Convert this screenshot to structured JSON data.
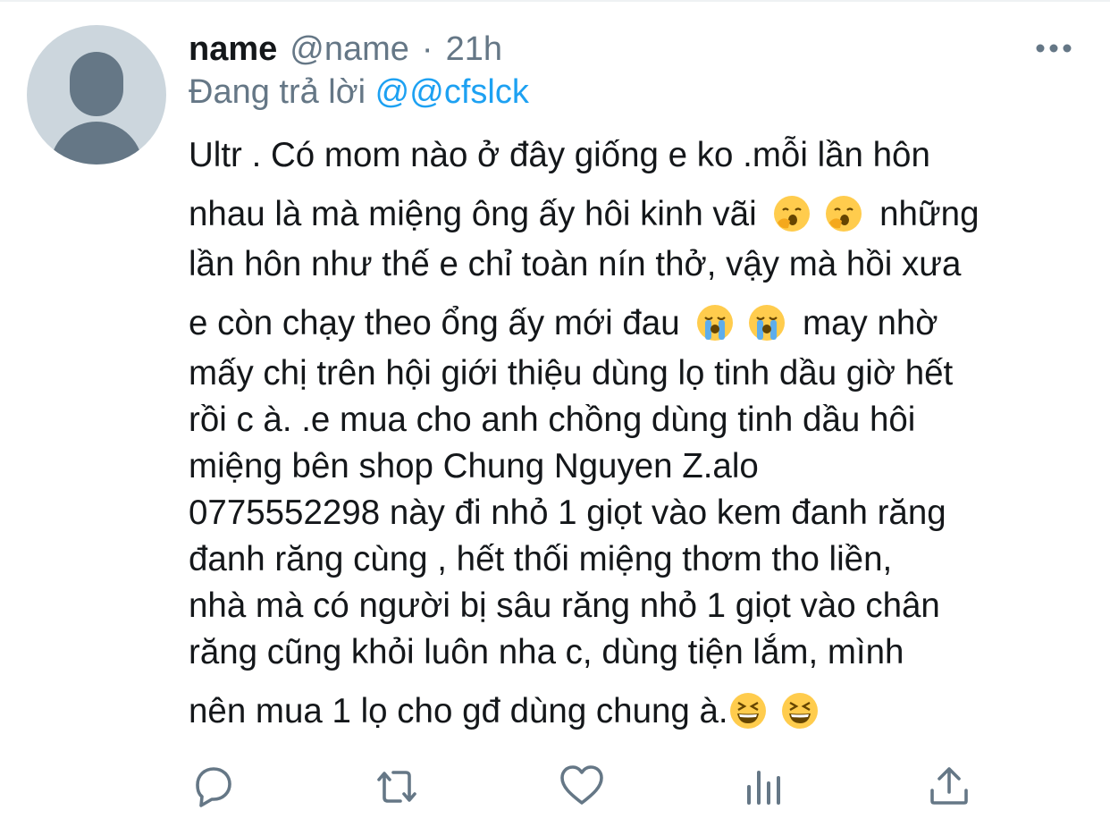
{
  "tweet": {
    "display_name": "name",
    "handle": "@name",
    "separator": "·",
    "time": "21h",
    "replying_to_label": "Đang trả lời",
    "replying_to_mention": "@@cfslck",
    "lines": [
      "Ultr . Có mom nào ở đây giống e ko .mỗi lần hôn",
      "nhau là mà miệng ông ấy hôi kinh vãi",
      "những",
      "lần hôn như thế e chỉ toàn nín thở,  vậy mà hồi xưa",
      "e còn chạy theo ổng ấy mới đau",
      "may nhờ",
      "mấy chị trên hội giới thiệu dùng lọ tinh dầu giờ hết",
      "rồi c à. .e mua cho anh chồng dùng tinh dầu hôi",
      "miệng bên shop Chung Nguyen Z.alo",
      "0775552298 này đi nhỏ 1 giọt vào kem đanh răng",
      "đanh răng cùng , hết thối miệng thơm tho liền,",
      "nhà mà có người bị sâu răng nhỏ 1 giọt vào chân",
      "răng cũng khỏi luôn nha c, dùng tiện lắm, mình",
      "nên mua 1 lọ cho gđ dùng chung à."
    ],
    "emojis": {
      "line2": [
        "yawning-face-emoji",
        "yawning-face-emoji"
      ],
      "line5": [
        "loudly-crying-face-emoji",
        "loudly-crying-face-emoji"
      ],
      "line14": [
        "grinning-squinting-face-emoji",
        "grinning-squinting-face-emoji"
      ]
    }
  },
  "actions": {
    "icons": [
      "reply-icon",
      "retweet-icon",
      "like-icon",
      "analytics-icon",
      "share-icon"
    ]
  },
  "colors": {
    "text": "#14171a",
    "secondary": "#657786",
    "link": "#1da1f2",
    "avatar_bg": "#ccd6dd",
    "emoji_face": "#ffcc4d"
  }
}
